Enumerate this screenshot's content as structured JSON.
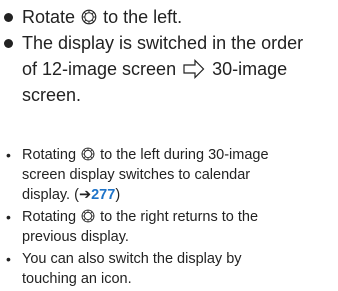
{
  "steps": [
    {
      "pre": "Rotate",
      "icon": "control-dial-icon",
      "post": "to the left."
    },
    {
      "line1": "The display is switched in the order",
      "line2_pre": "of 12-image screen",
      "icon": "right-arrow-icon",
      "line2_post": "30-image",
      "line3": "screen."
    }
  ],
  "notes": [
    {
      "pre": "Rotating",
      "icon": "control-dial-icon",
      "post1": "to the left during 30-image",
      "line2": "screen display switches to calendar",
      "line3_pre": "display. (",
      "ref_arrow": "➔",
      "page_ref": "277",
      "line3_post": ")"
    },
    {
      "pre": "Rotating",
      "icon": "control-dial-icon",
      "post1": "to the right returns to the",
      "line2": "previous display."
    },
    {
      "line1": "You can also switch the display by",
      "line2": "touching an icon."
    }
  ],
  "colors": {
    "text": "#222222",
    "link": "#1e73c8"
  }
}
